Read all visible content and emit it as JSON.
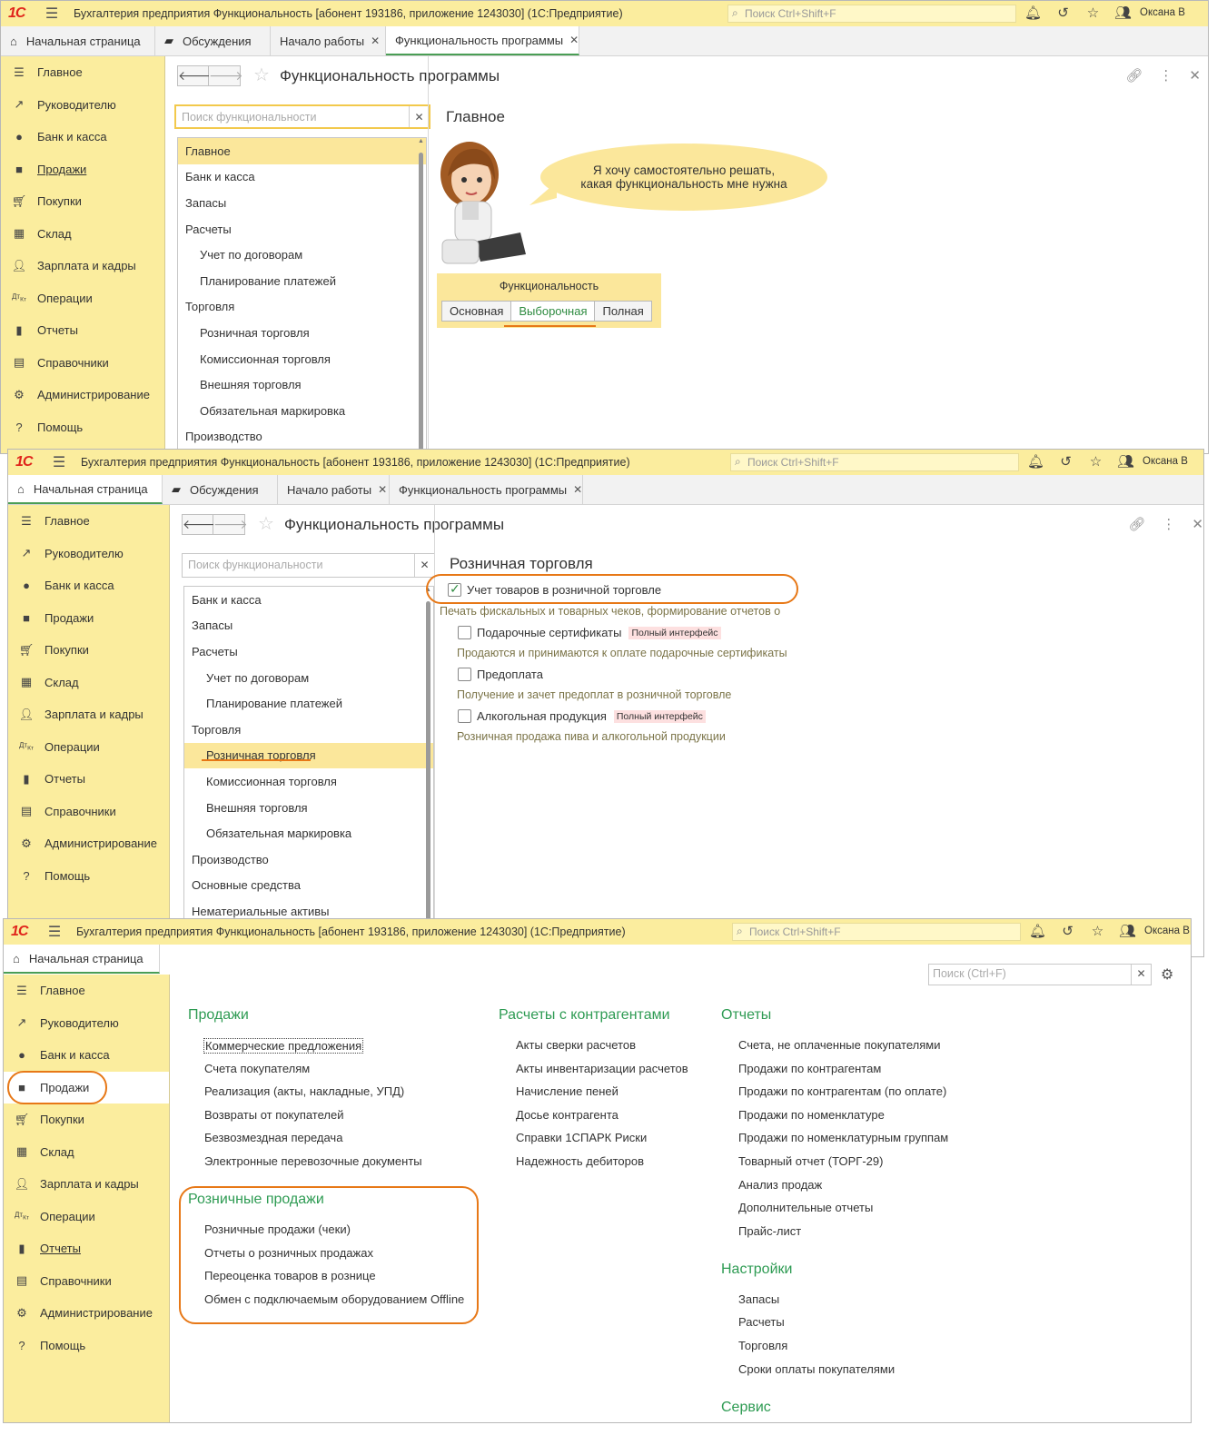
{
  "titlebar": {
    "title": "Бухгалтерия предприятия Функциональность [абонент 193186, приложение 1243030]  (1С:Предприятие)",
    "search_placeholder": "Поиск Ctrl+Shift+F",
    "user": "Оксана В",
    "logo": "1С"
  },
  "tabs": {
    "home": "Начальная страница",
    "discussions": "Обсуждения",
    "start": "Начало работы",
    "func": "Функциональность программы"
  },
  "sidebar": {
    "main": "Главное",
    "manager": "Руководителю",
    "bank": "Банк и касса",
    "sales": "Продажи",
    "purchases": "Покупки",
    "warehouse": "Склад",
    "salary": "Зарплата и кадры",
    "operations": "Операции",
    "reports": "Отчеты",
    "directories": "Справочники",
    "admin": "Администрирование",
    "help": "Помощь"
  },
  "func_page": {
    "title": "Функциональность программы",
    "search_placeholder": "Поиск функциональности",
    "tree": {
      "main": "Главное",
      "bank": "Банк и касса",
      "stock": "Запасы",
      "settlements": "Расчеты",
      "contracts": "Учет по договорам",
      "payments": "Планирование платежей",
      "trade": "Торговля",
      "retail": "Розничная торговля",
      "commission": "Комиссионная торговля",
      "foreign": "Внешняя торговля",
      "marking": "Обязательная маркировка",
      "production": "Производство",
      "fixed_assets": "Основные средства",
      "intangible": "Нематериальные активы"
    }
  },
  "win1": {
    "section": "Главное",
    "speech_line1": "Я хочу самостоятельно решать,",
    "speech_line2": "какая функциональность мне нужна",
    "func_label": "Функциональность",
    "opt_basic": "Основная",
    "opt_selective": "Выборочная",
    "opt_full": "Полная"
  },
  "win2": {
    "section": "Розничная торговля",
    "retail_accounting": "Учет товаров в розничной торговле",
    "retail_accounting_desc": "Печать фискальных и товарных чеков, формирование отчетов о",
    "gift": "Подарочные сертификаты",
    "gift_desc": "Продаются и принимаются к оплате подарочные сертификаты",
    "prepay": "Предоплата",
    "prepay_desc": "Получение и зачет предоплат в розничной торговле",
    "alcohol": "Алкогольная продукция",
    "alcohol_desc": "Розничная продажа пива и алкогольной продукции",
    "badge": "Полный интерфейс"
  },
  "win3": {
    "search_placeholder": "Поиск (Ctrl+F)",
    "sales_h": "Продажи",
    "sales": [
      "Коммерческие предложения",
      "Счета покупателям",
      "Реализация (акты, накладные, УПД)",
      "Возвраты от покупателей",
      "Безвозмездная передача",
      "Электронные перевозочные документы"
    ],
    "retail_h": "Розничные продажи",
    "retail": [
      "Розничные продажи (чеки)",
      "Отчеты о розничных продажах",
      "Переоценка товаров в рознице",
      "Обмен с подключаемым оборудованием Offline"
    ],
    "settle_h": "Расчеты с контрагентами",
    "settle": [
      "Акты сверки расчетов",
      "Акты инвентаризации расчетов",
      "Начисление пеней",
      "Досье контрагента",
      "Справки 1СПАРК Риски",
      "Надежность дебиторов"
    ],
    "reports_h": "Отчеты",
    "reports": [
      "Счета, не оплаченные покупателями",
      "Продажи по контрагентам",
      "Продажи по контрагентам (по оплате)",
      "Продажи по номенклатуре",
      "Продажи по номенклатурным группам",
      "Товарный отчет (ТОРГ-29)",
      "Анализ продаж",
      "Дополнительные отчеты",
      "Прайс-лист"
    ],
    "settings_h": "Настройки",
    "settings": [
      "Запасы",
      "Расчеты",
      "Торговля",
      "Сроки оплаты покупателями"
    ],
    "service_h": "Сервис"
  },
  "colors": {
    "bar": "#fbed9e",
    "accent_green": "#2e9b53",
    "highlight": "#e77817",
    "selected": "#fbe79b"
  }
}
